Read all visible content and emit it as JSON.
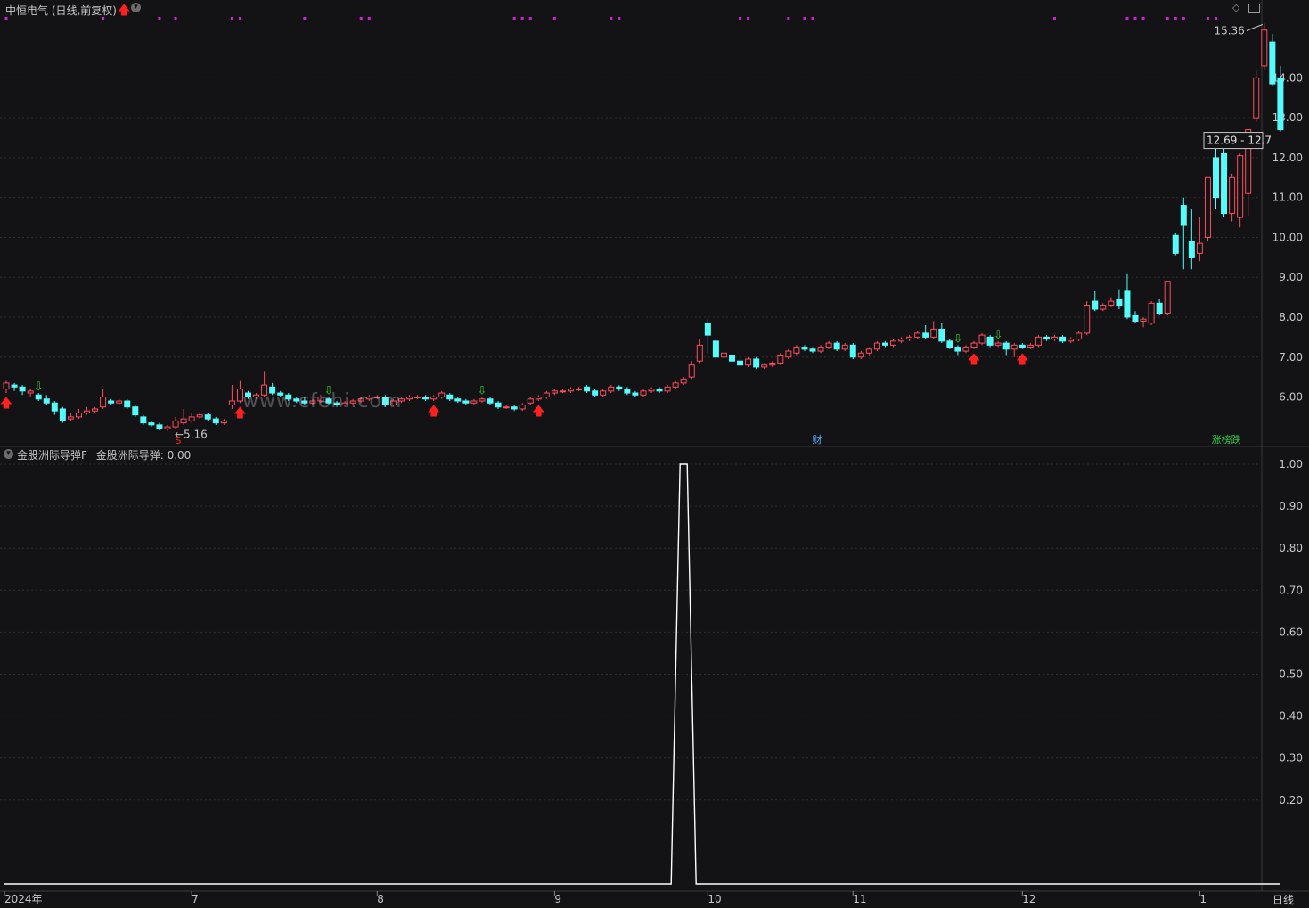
{
  "header": {
    "stock_title": "中恒电气 (日线,前复权)",
    "indicator_title": "金股洲际导弹F",
    "indicator_value_label": "金股洲际导弹: 0.00"
  },
  "watermark": "www.cfehi.com",
  "period_label": "日线",
  "price_annotations": {
    "high": "15.36",
    "low": "5.16",
    "last_range": "12.69 - 12.7"
  },
  "event_labels": {
    "finance": "财",
    "rank": "涨榜跌",
    "signal_s": "S"
  },
  "colors": {
    "background": "#131214",
    "up": "#ff4d5e",
    "down": "#54fcfc",
    "signal_dots": "#d11fd6",
    "arrow_up": "#ff2020",
    "arrow_down": "#32c832",
    "indicator_line": "#ffffff"
  },
  "icons": [
    "chevron-down-icon",
    "diamond-icon",
    "window-icon",
    "up-arrow-icon",
    "down-arrow-icon"
  ],
  "chart_data": [
    {
      "type": "candlestick",
      "title": "中恒电气 (日线,前复权)",
      "y_ticks": [
        "14.00",
        "13.00",
        "12.00",
        "11.00",
        "10.00",
        "9.00",
        "8.00",
        "7.00",
        "6.00"
      ],
      "ylim": [
        4.85,
        15.55
      ],
      "x_ticks": [
        "2024年",
        "7",
        "8",
        "9",
        "10",
        "11",
        "12",
        "1"
      ],
      "grid": true,
      "candles": [
        [
          6.2,
          6.35,
          6.4,
          6.1
        ],
        [
          6.3,
          6.25,
          6.35,
          6.15
        ],
        [
          6.25,
          6.15,
          6.3,
          6.05
        ],
        [
          6.1,
          6.15,
          6.2,
          6.0
        ],
        [
          6.05,
          5.95,
          6.1,
          5.9
        ],
        [
          5.95,
          5.85,
          6.05,
          5.8
        ],
        [
          5.85,
          5.65,
          5.9,
          5.55
        ],
        [
          5.7,
          5.4,
          5.75,
          5.35
        ],
        [
          5.45,
          5.5,
          5.6,
          5.4
        ],
        [
          5.5,
          5.6,
          5.7,
          5.45
        ],
        [
          5.6,
          5.65,
          5.75,
          5.55
        ],
        [
          5.65,
          5.7,
          5.75,
          5.6
        ],
        [
          5.75,
          6.0,
          6.2,
          5.7
        ],
        [
          5.9,
          5.85,
          5.95,
          5.8
        ],
        [
          5.85,
          5.9,
          5.95,
          5.8
        ],
        [
          5.9,
          5.75,
          5.95,
          5.7
        ],
        [
          5.75,
          5.55,
          5.8,
          5.5
        ],
        [
          5.5,
          5.35,
          5.55,
          5.3
        ],
        [
          5.35,
          5.3,
          5.4,
          5.25
        ],
        [
          5.3,
          5.2,
          5.35,
          5.16
        ],
        [
          5.2,
          5.25,
          5.3,
          5.15
        ],
        [
          5.25,
          5.4,
          5.5,
          5.2
        ],
        [
          5.35,
          5.45,
          5.7,
          5.3
        ],
        [
          5.4,
          5.5,
          5.6,
          5.35
        ],
        [
          5.5,
          5.55,
          5.6,
          5.45
        ],
        [
          5.55,
          5.45,
          5.6,
          5.4
        ],
        [
          5.45,
          5.35,
          5.5,
          5.3
        ],
        [
          5.35,
          5.4,
          5.45,
          5.3
        ],
        [
          5.8,
          5.9,
          6.3,
          5.7
        ],
        [
          5.9,
          6.2,
          6.4,
          5.85
        ],
        [
          6.1,
          6.0,
          6.15,
          5.95
        ],
        [
          6.0,
          6.05,
          6.1,
          5.95
        ],
        [
          6.05,
          6.3,
          6.65,
          6.0
        ],
        [
          6.25,
          6.1,
          6.35,
          6.05
        ],
        [
          6.1,
          6.05,
          6.15,
          6.0
        ],
        [
          6.05,
          5.95,
          6.1,
          5.9
        ],
        [
          5.95,
          5.9,
          6.0,
          5.85
        ],
        [
          5.9,
          5.85,
          6.0,
          5.8
        ],
        [
          5.85,
          5.9,
          5.95,
          5.8
        ],
        [
          5.9,
          6.0,
          6.05,
          5.85
        ],
        [
          5.95,
          5.85,
          6.0,
          5.8
        ],
        [
          5.85,
          5.8,
          5.9,
          5.75
        ],
        [
          5.8,
          5.85,
          5.9,
          5.75
        ],
        [
          5.85,
          5.9,
          5.95,
          5.8
        ],
        [
          5.9,
          5.95,
          6.0,
          5.85
        ],
        [
          5.95,
          6.0,
          6.05,
          5.9
        ],
        [
          6.0,
          6.0,
          6.05,
          5.95
        ],
        [
          6.0,
          5.8,
          6.05,
          5.75
        ],
        [
          5.8,
          5.9,
          5.95,
          5.75
        ],
        [
          5.9,
          5.95,
          6.0,
          5.85
        ],
        [
          5.95,
          6.0,
          6.05,
          5.9
        ],
        [
          6.0,
          6.0,
          6.05,
          5.95
        ],
        [
          6.0,
          5.95,
          6.05,
          5.9
        ],
        [
          5.95,
          6.0,
          6.05,
          5.9
        ],
        [
          6.0,
          6.1,
          6.15,
          5.95
        ],
        [
          6.05,
          5.95,
          6.1,
          5.9
        ],
        [
          5.95,
          5.9,
          6.0,
          5.85
        ],
        [
          5.9,
          5.85,
          5.95,
          5.8
        ],
        [
          5.85,
          5.9,
          5.95,
          5.8
        ],
        [
          5.9,
          5.95,
          6.0,
          5.85
        ],
        [
          5.95,
          5.85,
          6.0,
          5.8
        ],
        [
          5.85,
          5.75,
          5.9,
          5.7
        ],
        [
          5.75,
          5.75,
          5.8,
          5.7
        ],
        [
          5.75,
          5.7,
          5.8,
          5.65
        ],
        [
          5.7,
          5.8,
          5.85,
          5.65
        ],
        [
          5.85,
          5.95,
          6.0,
          5.8
        ],
        [
          5.95,
          6.0,
          6.05,
          5.9
        ],
        [
          6.0,
          6.1,
          6.15,
          5.95
        ],
        [
          6.1,
          6.15,
          6.2,
          6.05
        ],
        [
          6.15,
          6.15,
          6.2,
          6.1
        ],
        [
          6.15,
          6.2,
          6.25,
          6.1
        ],
        [
          6.2,
          6.2,
          6.25,
          6.15
        ],
        [
          6.25,
          6.15,
          6.3,
          6.1
        ],
        [
          6.15,
          6.05,
          6.2,
          6.0
        ],
        [
          6.05,
          6.15,
          6.2,
          6.0
        ],
        [
          6.15,
          6.25,
          6.3,
          6.1
        ],
        [
          6.25,
          6.2,
          6.3,
          6.15
        ],
        [
          6.2,
          6.1,
          6.25,
          6.05
        ],
        [
          6.1,
          6.05,
          6.15,
          6.0
        ],
        [
          6.05,
          6.15,
          6.2,
          6.0
        ],
        [
          6.15,
          6.2,
          6.25,
          6.1
        ],
        [
          6.2,
          6.15,
          6.25,
          6.1
        ],
        [
          6.15,
          6.25,
          6.3,
          6.1
        ],
        [
          6.25,
          6.35,
          6.4,
          6.2
        ],
        [
          6.35,
          6.45,
          6.5,
          6.3
        ],
        [
          6.5,
          6.8,
          6.9,
          6.45
        ],
        [
          6.9,
          7.3,
          7.45,
          6.85
        ],
        [
          7.85,
          7.55,
          7.95,
          7.1
        ],
        [
          7.4,
          7.0,
          7.45,
          6.95
        ],
        [
          7.0,
          7.1,
          7.15,
          6.95
        ],
        [
          7.05,
          6.9,
          7.1,
          6.85
        ],
        [
          6.9,
          6.8,
          6.95,
          6.75
        ],
        [
          6.8,
          6.95,
          7.0,
          6.75
        ],
        [
          6.95,
          6.75,
          7.0,
          6.7
        ],
        [
          6.75,
          6.8,
          6.85,
          6.7
        ],
        [
          6.8,
          6.85,
          6.9,
          6.75
        ],
        [
          6.85,
          7.05,
          7.1,
          6.8
        ],
        [
          7.0,
          7.15,
          7.2,
          6.95
        ],
        [
          7.1,
          7.25,
          7.3,
          7.05
        ],
        [
          7.25,
          7.2,
          7.3,
          7.15
        ],
        [
          7.2,
          7.15,
          7.25,
          7.1
        ],
        [
          7.15,
          7.25,
          7.3,
          7.1
        ],
        [
          7.25,
          7.35,
          7.4,
          7.2
        ],
        [
          7.35,
          7.2,
          7.4,
          7.15
        ],
        [
          7.2,
          7.3,
          7.35,
          7.15
        ],
        [
          7.3,
          7.0,
          7.35,
          6.95
        ],
        [
          7.0,
          7.1,
          7.15,
          6.95
        ],
        [
          7.1,
          7.2,
          7.25,
          7.05
        ],
        [
          7.2,
          7.35,
          7.4,
          7.15
        ],
        [
          7.35,
          7.3,
          7.4,
          7.25
        ],
        [
          7.3,
          7.4,
          7.45,
          7.25
        ],
        [
          7.4,
          7.45,
          7.5,
          7.35
        ],
        [
          7.45,
          7.5,
          7.55,
          7.4
        ],
        [
          7.5,
          7.6,
          7.65,
          7.45
        ],
        [
          7.6,
          7.5,
          7.8,
          7.45
        ],
        [
          7.5,
          7.7,
          7.9,
          7.45
        ],
        [
          7.7,
          7.4,
          7.85,
          7.35
        ],
        [
          7.4,
          7.25,
          7.45,
          7.2
        ],
        [
          7.25,
          7.15,
          7.3,
          7.05
        ],
        [
          7.15,
          7.25,
          7.3,
          7.1
        ],
        [
          7.25,
          7.35,
          7.4,
          7.2
        ],
        [
          7.35,
          7.55,
          7.6,
          7.3
        ],
        [
          7.5,
          7.3,
          7.55,
          7.25
        ],
        [
          7.3,
          7.35,
          7.4,
          7.25
        ],
        [
          7.35,
          7.2,
          7.4,
          7.05
        ],
        [
          7.2,
          7.3,
          7.35,
          7.0
        ],
        [
          7.3,
          7.25,
          7.35,
          7.2
        ],
        [
          7.25,
          7.3,
          7.35,
          7.2
        ],
        [
          7.3,
          7.5,
          7.55,
          7.25
        ],
        [
          7.5,
          7.45,
          7.55,
          7.4
        ],
        [
          7.45,
          7.5,
          7.55,
          7.4
        ],
        [
          7.5,
          7.4,
          7.55,
          7.35
        ],
        [
          7.4,
          7.45,
          7.5,
          7.35
        ],
        [
          7.45,
          7.6,
          7.65,
          7.4
        ],
        [
          7.6,
          8.3,
          8.4,
          7.55
        ],
        [
          8.4,
          8.2,
          8.65,
          8.15
        ],
        [
          8.2,
          8.3,
          8.35,
          8.15
        ],
        [
          8.3,
          8.4,
          8.5,
          8.25
        ],
        [
          8.45,
          8.3,
          8.7,
          8.2
        ],
        [
          8.65,
          8.0,
          9.1,
          7.95
        ],
        [
          8.05,
          7.9,
          8.15,
          7.85
        ],
        [
          7.9,
          7.95,
          8.0,
          7.75
        ],
        [
          7.85,
          8.35,
          8.4,
          7.8
        ],
        [
          8.35,
          8.1,
          8.45,
          8.05
        ],
        [
          8.1,
          8.9,
          8.9,
          8.05
        ],
        [
          10.05,
          9.6,
          10.1,
          9.55
        ],
        [
          10.8,
          10.3,
          11.0,
          9.2
        ],
        [
          9.9,
          9.5,
          10.7,
          9.2
        ],
        [
          9.6,
          9.85,
          10.5,
          9.4
        ],
        [
          10.0,
          11.5,
          11.5,
          9.9
        ],
        [
          12.0,
          11.0,
          12.6,
          10.7
        ],
        [
          12.1,
          10.6,
          12.6,
          10.5
        ],
        [
          10.6,
          11.5,
          11.6,
          10.4
        ],
        [
          10.5,
          12.05,
          12.1,
          10.25
        ],
        [
          11.1,
          12.7,
          12.7,
          10.55
        ],
        [
          13.0,
          14.0,
          14.2,
          12.9
        ],
        [
          14.3,
          15.2,
          15.36,
          14.2
        ],
        [
          14.9,
          13.85,
          15.1,
          13.8
        ],
        [
          14.0,
          12.7,
          14.3,
          12.65
        ]
      ]
    },
    {
      "type": "line",
      "title": "金股洲际导弹F",
      "series": [
        {
          "name": "金股洲际导弹",
          "peak_index": 84,
          "peak_value": 1.0,
          "baseline": 0.0
        }
      ],
      "y_ticks": [
        "1.00",
        "0.90",
        "0.80",
        "0.70",
        "0.60",
        "0.50",
        "0.40",
        "0.30",
        "0.20"
      ],
      "ylim": [
        0.0,
        1.0
      ],
      "x_ticks": [
        "2024年",
        "7",
        "8",
        "9",
        "10",
        "11",
        "12",
        "1"
      ],
      "grid": true
    }
  ]
}
